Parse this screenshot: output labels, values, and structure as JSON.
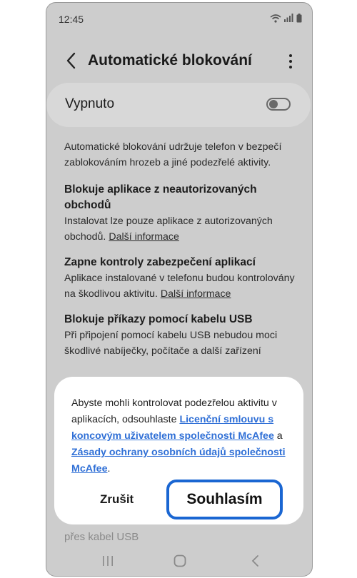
{
  "status": {
    "time": "12:45"
  },
  "appbar": {
    "title": "Automatické blokování"
  },
  "master": {
    "label": "Vypnuto",
    "on": false
  },
  "content": {
    "intro": "Automatické blokování udržuje telefon v bezpečí zablokováním hrozeb a jiné podezřelé aktivity.",
    "sections": [
      {
        "title": "Blokuje aplikace z neautorizovaných obchodů",
        "desc": "Instalovat lze pouze aplikace z autorizovaných obchodů.",
        "link": "Další informace"
      },
      {
        "title": "Zapne kontroly zabezpečení aplikací",
        "desc": "Aplikace instalované v telefonu budou kontrolovány na škodlivou aktivitu.",
        "link": "Další informace"
      },
      {
        "title": "Blokuje příkazy pomocí kabelu USB",
        "desc": "Při připojení pomocí kabelu USB nebudou moci škodlivé nabíječky, počítače a další zařízení",
        "link": ""
      }
    ],
    "tail": "přes kabel USB"
  },
  "dialog": {
    "text_before": "Abyste mohli kontrolovat podezřelou aktivitu v aplikacích, odsouhlaste",
    "link1": "Licenční smlouvu s koncovým uživatelem společnosti McAfee",
    "text_mid": "a",
    "link2": "Zásady ochrany osobních údajů společnosti McAfee",
    "text_end": ".",
    "cancel_label": "Zrušit",
    "agree_label": "Souhlasím"
  },
  "colors": {
    "accent": "#1a66d2",
    "link": "#2f6fd6",
    "dim_background": "#cdcdcd"
  }
}
